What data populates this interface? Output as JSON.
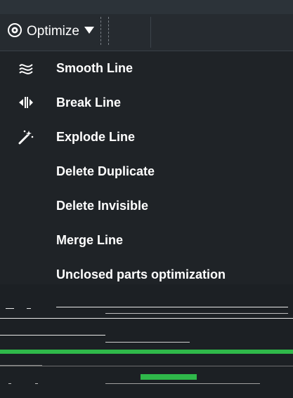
{
  "toolbar": {
    "optimize_label": "Optimize",
    "optimize_icon": "gear-circle-icon",
    "dropdown_icon": "caret-down-icon"
  },
  "menu": {
    "items": [
      {
        "label": "Smooth Line",
        "icon": "smooth-line-icon"
      },
      {
        "label": "Break Line",
        "icon": "break-line-icon"
      },
      {
        "label": "Explode Line",
        "icon": "magic-wand-icon"
      },
      {
        "label": "Delete Duplicate",
        "icon": ""
      },
      {
        "label": "Delete Invisible",
        "icon": ""
      },
      {
        "label": "Merge Line",
        "icon": ""
      },
      {
        "label": "Unclosed parts optimization",
        "icon": ""
      }
    ]
  },
  "colors": {
    "background": "#1f2327",
    "toolbar": "#262b30",
    "text": "#ffffff",
    "accent_green": "#2fb84a"
  }
}
